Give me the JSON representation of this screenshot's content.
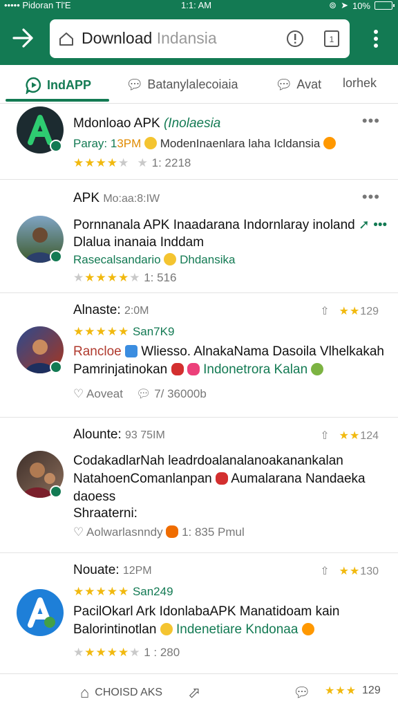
{
  "status": {
    "left": "••••• Pidoran  Tl'E",
    "time": "1:1: AM",
    "battery": "10%"
  },
  "browser": {
    "url_main": "Download",
    "url_tail": "Indansia"
  },
  "tabs": [
    {
      "label": "IndAPP"
    },
    {
      "label": "Batanylalecoiaia"
    },
    {
      "label": "Avat"
    },
    {
      "label": "lorhek"
    }
  ],
  "posts": [
    {
      "title": "Mdonloao APK",
      "title_tail": "(Inolaesia",
      "line2_a": "Paray: 1",
      "line2_b": "3PM",
      "line2_c": "ModenInaenlara laha Icldansia",
      "rating_count": "1: 2218",
      "menu": "•••"
    },
    {
      "header": "APK",
      "header_meta": "Mo:aa:8:IW",
      "body1": "Pornnanala APK Inaadarana Indornlaray inoland",
      "body2": "Dlalua inanaia Inddam",
      "tag_a": "Rasecalsandario",
      "tag_b": "Dhdansika",
      "rating_count": "1: 516",
      "menu": "•••"
    },
    {
      "header": "Alnaste:",
      "header_meta": "2:0M",
      "right_rating": "129",
      "sub_meta": "San7K9",
      "body1_a": "Rancloe",
      "body1_b": "Wliesso. AlnakaNama Dasoila Vlhelkakah",
      "body2_a": "Pamrinjatinokan",
      "body2_b": "Indonetrora Kalan",
      "action1": "Aoveat",
      "action2": "7/ 36000b"
    },
    {
      "header": "Alounte:",
      "header_meta": "93 75IM",
      "right_rating": "124",
      "body1": "CodakadlarNah leadrdoalanalanoakanankalan",
      "body2_a": "NatahoenComanlanpan",
      "body2_b": "Aumalarana Nandaeka",
      "body3": "daoess",
      "body4": "Shraaterni:",
      "action1": "Aolwarlasnndy",
      "action2": "1: 835 Pmul"
    },
    {
      "header": "Nouate:",
      "header_meta": "12PM",
      "right_rating": "130",
      "sub_meta": "San249",
      "body1": "PacilOkarl Ark IdonlabaAPK Manatidoam  kain",
      "body2_a": "Balorintinotlan",
      "body2_b": "Indenetiare Kndonaa",
      "rating_count": "1 : 280"
    }
  ],
  "bottom": {
    "center_label": "CHOISD AKS",
    "right_rating": "129"
  },
  "colors": {
    "brand": "#137a53",
    "star": "#f1b90f"
  }
}
